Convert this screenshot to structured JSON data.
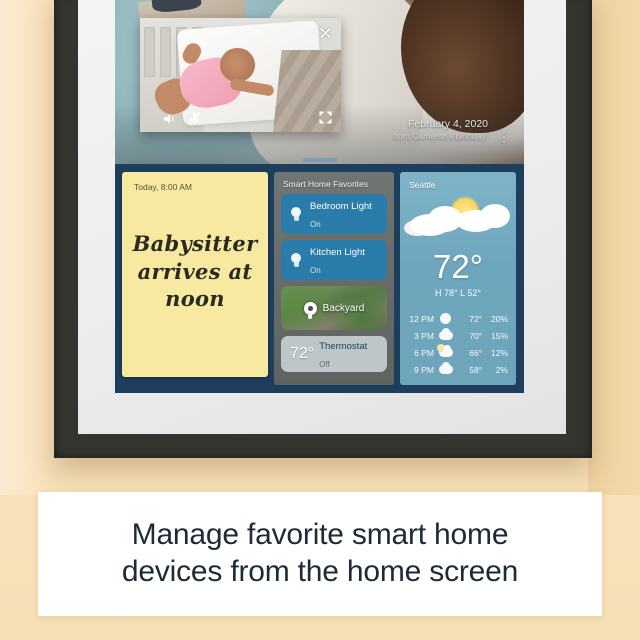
{
  "caption": {
    "line1": "Manage favorite smart home",
    "line2": "devices from the home screen"
  },
  "screen": {
    "photo": {
      "date": "February 4, 2020",
      "subtitle": "from Cameron's birthday!",
      "overflow_menu": "more-options",
      "camera_feed": {
        "close": "close",
        "expand": "expand",
        "speaker": "speaker",
        "mic_muted": "mic-muted"
      }
    },
    "note_widget": {
      "timestamp": "Today, 8:00 AM",
      "body": "Babysitter arrives at noon"
    },
    "smart_home": {
      "title": "Smart Home Favorites",
      "devices": [
        {
          "name": "Bedroom Light",
          "state": "On",
          "type": "light"
        },
        {
          "name": "Kitchen Light",
          "state": "On",
          "type": "light"
        },
        {
          "name": "Backyard",
          "state": "",
          "type": "camera"
        },
        {
          "name": "Thermostat",
          "state": "Off",
          "type": "thermostat",
          "temp": "72°"
        }
      ]
    },
    "weather": {
      "city": "Seattle",
      "temp": "72°",
      "high_low": "H 78° L 52°",
      "forecast": [
        {
          "time": "12 PM",
          "icon": "sun",
          "temp": "72°",
          "precip": "20%"
        },
        {
          "time": "3 PM",
          "icon": "cloud",
          "temp": "70°",
          "precip": "15%"
        },
        {
          "time": "6 PM",
          "icon": "partly-cloudy",
          "temp": "66°",
          "precip": "12%"
        },
        {
          "time": "9 PM",
          "icon": "cloud",
          "temp": "58°",
          "precip": "2%"
        }
      ]
    }
  },
  "colors": {
    "background": "#f9e2bb",
    "frame": "#35352f",
    "screen_bg": "#1d3e5c",
    "tile_on": "#2a7cab",
    "note": "#f7e9a0",
    "weather": "#6fa5bb",
    "caption_text": "#1f2a37"
  }
}
